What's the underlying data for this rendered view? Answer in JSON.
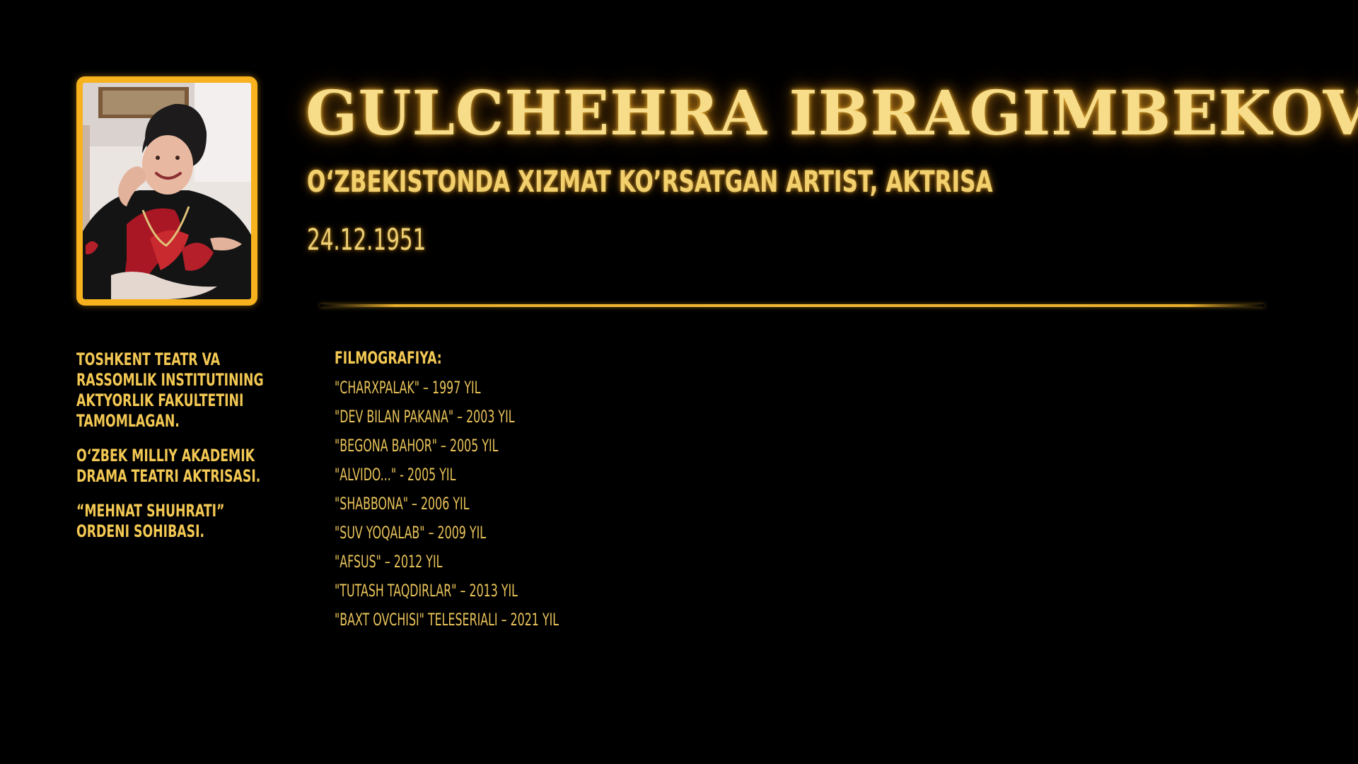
{
  "header": {
    "name": "GULCHEHRA IBRAGIMBEKOVA",
    "title": "O‘ZBEKISTONDA XIZMAT KO’RSATGAN ARTIST, AKTRISA",
    "date": "24.12.1951"
  },
  "bio": {
    "items": [
      "TOSHKENT TEATR VA RASSOMLIK INSTITUTINING AKTYORLIK FAKULTETINI TAMOMLAGAN.",
      "O‘ZBEK MILLIY AKADEMIK DRAMA TEATRI AKTRISASI.",
      "“MEHNAT SHUHRATI” ORDENI SOHIBASI."
    ]
  },
  "filmography": {
    "heading": "FILMOGRAFIYA:",
    "items": [
      "\"CHARXPALAK\" – 1997 YIL",
      "\"DEV BILAN PAKANA\" – 2003 YIL",
      "\"BEGONA BAHOR\" – 2005 YIL",
      "\"ALVIDO...\" - 2005 YIL",
      "\"SHABBONA\" – 2006 YIL",
      "\"SUV YOQALAB\" – 2009 YIL",
      "\"AFSUS\" – 2012 YIL",
      "\"TUTASH TAQDIRLAR\" – 2013 YIL",
      "\"BAXT OVCHISI\" TELESERIALI – 2021 YIL"
    ]
  },
  "colors": {
    "background": "#000000",
    "accent": "#f7b21e",
    "title_text": "#f7dc8a",
    "body_text": "#f3c853"
  },
  "icons": {
    "portrait": "portrait-photo-icon"
  }
}
